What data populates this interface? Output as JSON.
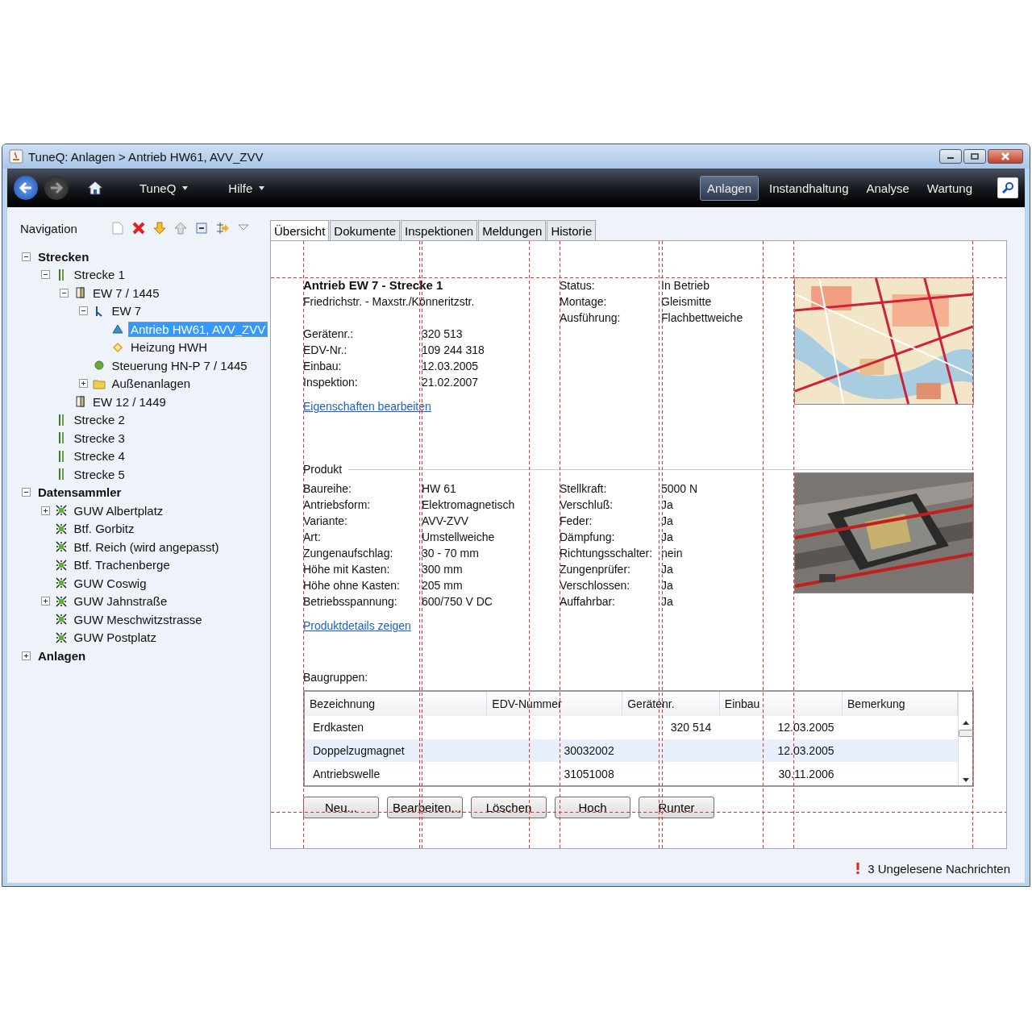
{
  "window": {
    "title": "TuneQ: Anlagen > Antrieb HW61, AVV_ZVV"
  },
  "toolbar": {
    "menus": [
      "TuneQ",
      "Hilfe"
    ],
    "nav_tabs": [
      {
        "label": "Anlagen",
        "selected": true
      },
      {
        "label": "Instandhaltung",
        "selected": false
      },
      {
        "label": "Analyse",
        "selected": false
      },
      {
        "label": "Wartung",
        "selected": false
      }
    ]
  },
  "navigation": {
    "title": "Navigation",
    "tree": [
      {
        "label": "Strecken",
        "expanded": true,
        "selected": false,
        "children": [
          {
            "label": "Strecke 1",
            "kind": "track",
            "expanded": true,
            "selected": false,
            "children": [
              {
                "label": "EW 7 / 1445",
                "kind": "cabinet",
                "expanded": true,
                "selected": false,
                "children": [
                  {
                    "label": "EW 7",
                    "kind": "switch",
                    "expanded": true,
                    "selected": false,
                    "children": [
                      {
                        "label": "Antrieb HW61, AVV_ZVV",
                        "kind": "drive",
                        "selected": true
                      },
                      {
                        "label": "Heizung HWH",
                        "kind": "heater",
                        "selected": false
                      }
                    ]
                  },
                  {
                    "label": "Steuerung HN-P 7 / 1445",
                    "kind": "control",
                    "selected": false
                  },
                  {
                    "label": "Außenanlagen",
                    "kind": "folder",
                    "expanded": false,
                    "selected": false
                  }
                ]
              },
              {
                "label": "EW 12 / 1449",
                "kind": "cabinet",
                "selected": false
              }
            ]
          },
          {
            "label": "Strecke 2",
            "kind": "track",
            "selected": false
          },
          {
            "label": "Strecke 3",
            "kind": "track",
            "selected": false
          },
          {
            "label": "Strecke 4",
            "kind": "track",
            "selected": false
          },
          {
            "label": "Strecke 5",
            "kind": "track",
            "selected": false
          }
        ]
      },
      {
        "label": "Datensammler",
        "expanded": true,
        "selected": false,
        "children": [
          {
            "label": "GUW Albertplatz",
            "kind": "collector",
            "expanded": false,
            "selected": false
          },
          {
            "label": "Btf. Gorbitz",
            "kind": "collector",
            "selected": false
          },
          {
            "label": "Btf. Reich (wird angepasst)",
            "kind": "collector",
            "selected": false
          },
          {
            "label": "Btf. Trachenberge",
            "kind": "collector",
            "selected": false
          },
          {
            "label": "GUW Coswig",
            "kind": "collector",
            "selected": false
          },
          {
            "label": "GUW Jahnstraße",
            "kind": "collector",
            "expanded": false,
            "selected": false
          },
          {
            "label": "GUW Meschwitzstrasse",
            "kind": "collector",
            "selected": false
          },
          {
            "label": "GUW Postplatz",
            "kind": "collector",
            "selected": false
          }
        ]
      },
      {
        "label": "Anlagen",
        "expanded": false,
        "selected": false
      }
    ]
  },
  "tabs": [
    {
      "label": "Übersicht",
      "selected": true
    },
    {
      "label": "Dokumente",
      "selected": false
    },
    {
      "label": "Inspektionen",
      "selected": false
    },
    {
      "label": "Meldungen",
      "selected": false
    },
    {
      "label": "Historie",
      "selected": false
    }
  ],
  "overview": {
    "title": "Antrieb EW 7 - Strecke 1",
    "subtitle": "Friedrichstr. - Maxstr./Könneritzstr.",
    "fields": [
      {
        "label": "Gerätenr.:",
        "value": "320 513"
      },
      {
        "label": "EDV-Nr.:",
        "value": "109 244 318"
      },
      {
        "label": "Einbau:",
        "value": "12.03.2005"
      },
      {
        "label": "Inspektion:",
        "value": "21.02.2007"
      }
    ],
    "edit_link": "Eigenschaften bearbeiten",
    "status_fields": [
      {
        "label": "Status:",
        "value": "In Betrieb"
      },
      {
        "label": "Montage:",
        "value": "Gleismitte"
      },
      {
        "label": "Ausführung:",
        "value": "Flachbettweiche"
      }
    ]
  },
  "product": {
    "title": "Produkt",
    "fields_left": [
      {
        "label": "Baureihe:",
        "value": "HW 61"
      },
      {
        "label": "Antriebsform:",
        "value": "Elektromagnetisch"
      },
      {
        "label": "Variante:",
        "value": "AVV-ZVV"
      },
      {
        "label": "Art:",
        "value": "Umstellweiche"
      },
      {
        "label": "Zungenaufschlag:",
        "value": "30 - 70 mm"
      },
      {
        "label": "Höhe mit Kasten:",
        "value": "300 mm"
      },
      {
        "label": "Höhe ohne Kasten:",
        "value": "205 mm"
      },
      {
        "label": "Betriebsspannung:",
        "value": "600/750 V DC"
      }
    ],
    "fields_right": [
      {
        "label": "Stellkraft:",
        "value": "5000 N"
      },
      {
        "label": "Verschluß:",
        "value": "Ja"
      },
      {
        "label": "Feder:",
        "value": "Ja"
      },
      {
        "label": "Dämpfung:",
        "value": "Ja"
      },
      {
        "label": "Richtungsschalter:",
        "value": "nein"
      },
      {
        "label": "Zungenprüfer:",
        "value": "Ja"
      },
      {
        "label": "Verschlossen:",
        "value": "Ja"
      },
      {
        "label": "Auffahrbar:",
        "value": "Ja"
      }
    ],
    "details_link": "Produktdetails zeigen"
  },
  "assemblies": {
    "title": "Baugruppen:",
    "columns": [
      "Bezeichnung",
      "EDV-Nummer",
      "Gerätenr.",
      "Einbau",
      "Bemerkung"
    ],
    "rows": [
      [
        "Erdkasten",
        "",
        "320 514",
        "12.03.2005",
        ""
      ],
      [
        "Doppelzugmagnet",
        "30032002",
        "",
        "12.03.2005",
        ""
      ],
      [
        "Antriebswelle",
        "31051008",
        "",
        "30.11.2006",
        ""
      ]
    ],
    "buttons": [
      "Neu...",
      "Bearbeiten...",
      "Löschen",
      "Hoch",
      "Runter"
    ]
  },
  "status_bar": {
    "message": "3 Ungelesene Nachrichten"
  }
}
